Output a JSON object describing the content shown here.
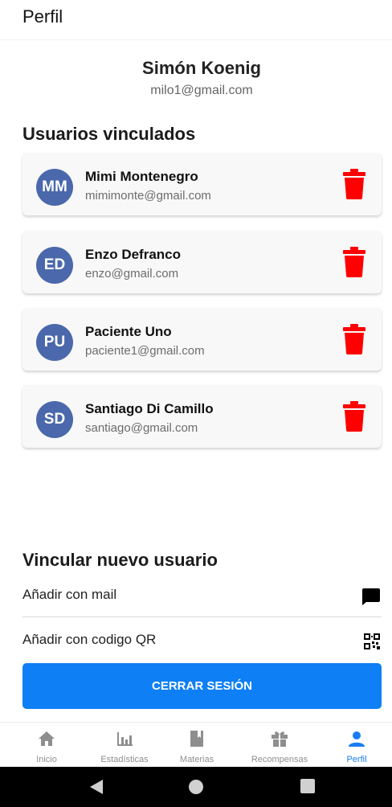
{
  "header": {
    "title": "Perfil"
  },
  "profile": {
    "name": "Simón Koenig",
    "email": "milo1@gmail.com"
  },
  "linked_section": {
    "title": "Usuarios vinculados"
  },
  "linked_users": [
    {
      "initials": "MM",
      "name": "Mimi Montenegro",
      "email": "mimimonte@gmail.com"
    },
    {
      "initials": "ED",
      "name": "Enzo Defranco",
      "email": "enzo@gmail.com"
    },
    {
      "initials": "PU",
      "name": "Paciente Uno",
      "email": "paciente1@gmail.com"
    },
    {
      "initials": "SD",
      "name": "Santiago Di Camillo",
      "email": "santiago@gmail.com"
    }
  ],
  "link_new": {
    "title": "Vincular nuevo usuario",
    "options": [
      {
        "label": "Añadir con mail",
        "icon": "chat-bubble-icon"
      },
      {
        "label": "Añadir con codigo QR",
        "icon": "qr-code-icon"
      }
    ]
  },
  "logout_button": {
    "label": "CERRAR SESIÓN"
  },
  "tabs": [
    {
      "label": "Inicio",
      "icon": "home-icon",
      "active": false
    },
    {
      "label": "Estadísticas",
      "icon": "bar-chart-icon",
      "active": false
    },
    {
      "label": "Materias",
      "icon": "book-icon",
      "active": false
    },
    {
      "label": "Recompensas",
      "icon": "gift-icon",
      "active": false
    },
    {
      "label": "Perfil",
      "icon": "user-icon",
      "active": true
    }
  ],
  "colors": {
    "accent": "#0e7ff5",
    "active_tab": "#1a7cf4",
    "avatar_bg": "#4a68ab",
    "delete": "#ff0000",
    "inactive_tab": "#8e8e8e"
  }
}
